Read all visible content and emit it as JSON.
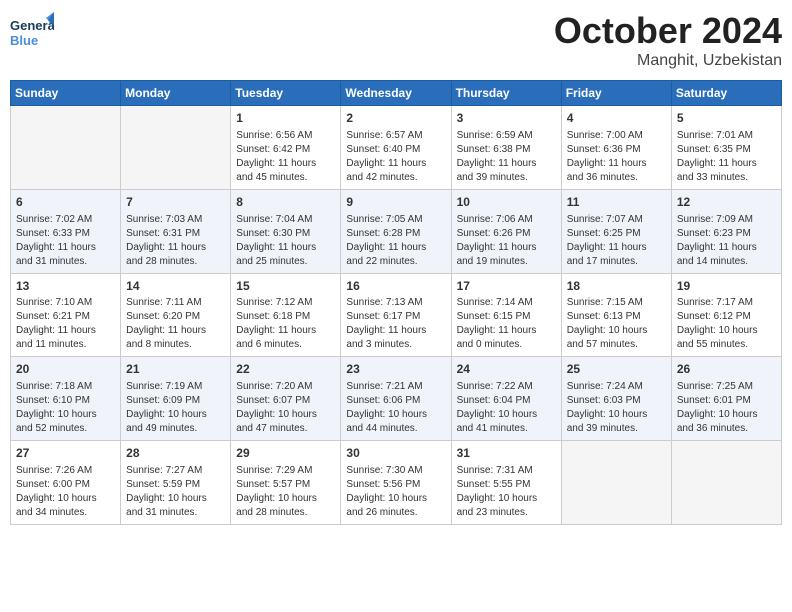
{
  "header": {
    "logo_general": "General",
    "logo_blue": "Blue",
    "month": "October 2024",
    "location": "Manghit, Uzbekistan"
  },
  "weekdays": [
    "Sunday",
    "Monday",
    "Tuesday",
    "Wednesday",
    "Thursday",
    "Friday",
    "Saturday"
  ],
  "weeks": [
    [
      {
        "day": "",
        "info": ""
      },
      {
        "day": "",
        "info": ""
      },
      {
        "day": "1",
        "info": "Sunrise: 6:56 AM\nSunset: 6:42 PM\nDaylight: 11 hours and 45 minutes."
      },
      {
        "day": "2",
        "info": "Sunrise: 6:57 AM\nSunset: 6:40 PM\nDaylight: 11 hours and 42 minutes."
      },
      {
        "day": "3",
        "info": "Sunrise: 6:59 AM\nSunset: 6:38 PM\nDaylight: 11 hours and 39 minutes."
      },
      {
        "day": "4",
        "info": "Sunrise: 7:00 AM\nSunset: 6:36 PM\nDaylight: 11 hours and 36 minutes."
      },
      {
        "day": "5",
        "info": "Sunrise: 7:01 AM\nSunset: 6:35 PM\nDaylight: 11 hours and 33 minutes."
      }
    ],
    [
      {
        "day": "6",
        "info": "Sunrise: 7:02 AM\nSunset: 6:33 PM\nDaylight: 11 hours and 31 minutes."
      },
      {
        "day": "7",
        "info": "Sunrise: 7:03 AM\nSunset: 6:31 PM\nDaylight: 11 hours and 28 minutes."
      },
      {
        "day": "8",
        "info": "Sunrise: 7:04 AM\nSunset: 6:30 PM\nDaylight: 11 hours and 25 minutes."
      },
      {
        "day": "9",
        "info": "Sunrise: 7:05 AM\nSunset: 6:28 PM\nDaylight: 11 hours and 22 minutes."
      },
      {
        "day": "10",
        "info": "Sunrise: 7:06 AM\nSunset: 6:26 PM\nDaylight: 11 hours and 19 minutes."
      },
      {
        "day": "11",
        "info": "Sunrise: 7:07 AM\nSunset: 6:25 PM\nDaylight: 11 hours and 17 minutes."
      },
      {
        "day": "12",
        "info": "Sunrise: 7:09 AM\nSunset: 6:23 PM\nDaylight: 11 hours and 14 minutes."
      }
    ],
    [
      {
        "day": "13",
        "info": "Sunrise: 7:10 AM\nSunset: 6:21 PM\nDaylight: 11 hours and 11 minutes."
      },
      {
        "day": "14",
        "info": "Sunrise: 7:11 AM\nSunset: 6:20 PM\nDaylight: 11 hours and 8 minutes."
      },
      {
        "day": "15",
        "info": "Sunrise: 7:12 AM\nSunset: 6:18 PM\nDaylight: 11 hours and 6 minutes."
      },
      {
        "day": "16",
        "info": "Sunrise: 7:13 AM\nSunset: 6:17 PM\nDaylight: 11 hours and 3 minutes."
      },
      {
        "day": "17",
        "info": "Sunrise: 7:14 AM\nSunset: 6:15 PM\nDaylight: 11 hours and 0 minutes."
      },
      {
        "day": "18",
        "info": "Sunrise: 7:15 AM\nSunset: 6:13 PM\nDaylight: 10 hours and 57 minutes."
      },
      {
        "day": "19",
        "info": "Sunrise: 7:17 AM\nSunset: 6:12 PM\nDaylight: 10 hours and 55 minutes."
      }
    ],
    [
      {
        "day": "20",
        "info": "Sunrise: 7:18 AM\nSunset: 6:10 PM\nDaylight: 10 hours and 52 minutes."
      },
      {
        "day": "21",
        "info": "Sunrise: 7:19 AM\nSunset: 6:09 PM\nDaylight: 10 hours and 49 minutes."
      },
      {
        "day": "22",
        "info": "Sunrise: 7:20 AM\nSunset: 6:07 PM\nDaylight: 10 hours and 47 minutes."
      },
      {
        "day": "23",
        "info": "Sunrise: 7:21 AM\nSunset: 6:06 PM\nDaylight: 10 hours and 44 minutes."
      },
      {
        "day": "24",
        "info": "Sunrise: 7:22 AM\nSunset: 6:04 PM\nDaylight: 10 hours and 41 minutes."
      },
      {
        "day": "25",
        "info": "Sunrise: 7:24 AM\nSunset: 6:03 PM\nDaylight: 10 hours and 39 minutes."
      },
      {
        "day": "26",
        "info": "Sunrise: 7:25 AM\nSunset: 6:01 PM\nDaylight: 10 hours and 36 minutes."
      }
    ],
    [
      {
        "day": "27",
        "info": "Sunrise: 7:26 AM\nSunset: 6:00 PM\nDaylight: 10 hours and 34 minutes."
      },
      {
        "day": "28",
        "info": "Sunrise: 7:27 AM\nSunset: 5:59 PM\nDaylight: 10 hours and 31 minutes."
      },
      {
        "day": "29",
        "info": "Sunrise: 7:29 AM\nSunset: 5:57 PM\nDaylight: 10 hours and 28 minutes."
      },
      {
        "day": "30",
        "info": "Sunrise: 7:30 AM\nSunset: 5:56 PM\nDaylight: 10 hours and 26 minutes."
      },
      {
        "day": "31",
        "info": "Sunrise: 7:31 AM\nSunset: 5:55 PM\nDaylight: 10 hours and 23 minutes."
      },
      {
        "day": "",
        "info": ""
      },
      {
        "day": "",
        "info": ""
      }
    ]
  ]
}
